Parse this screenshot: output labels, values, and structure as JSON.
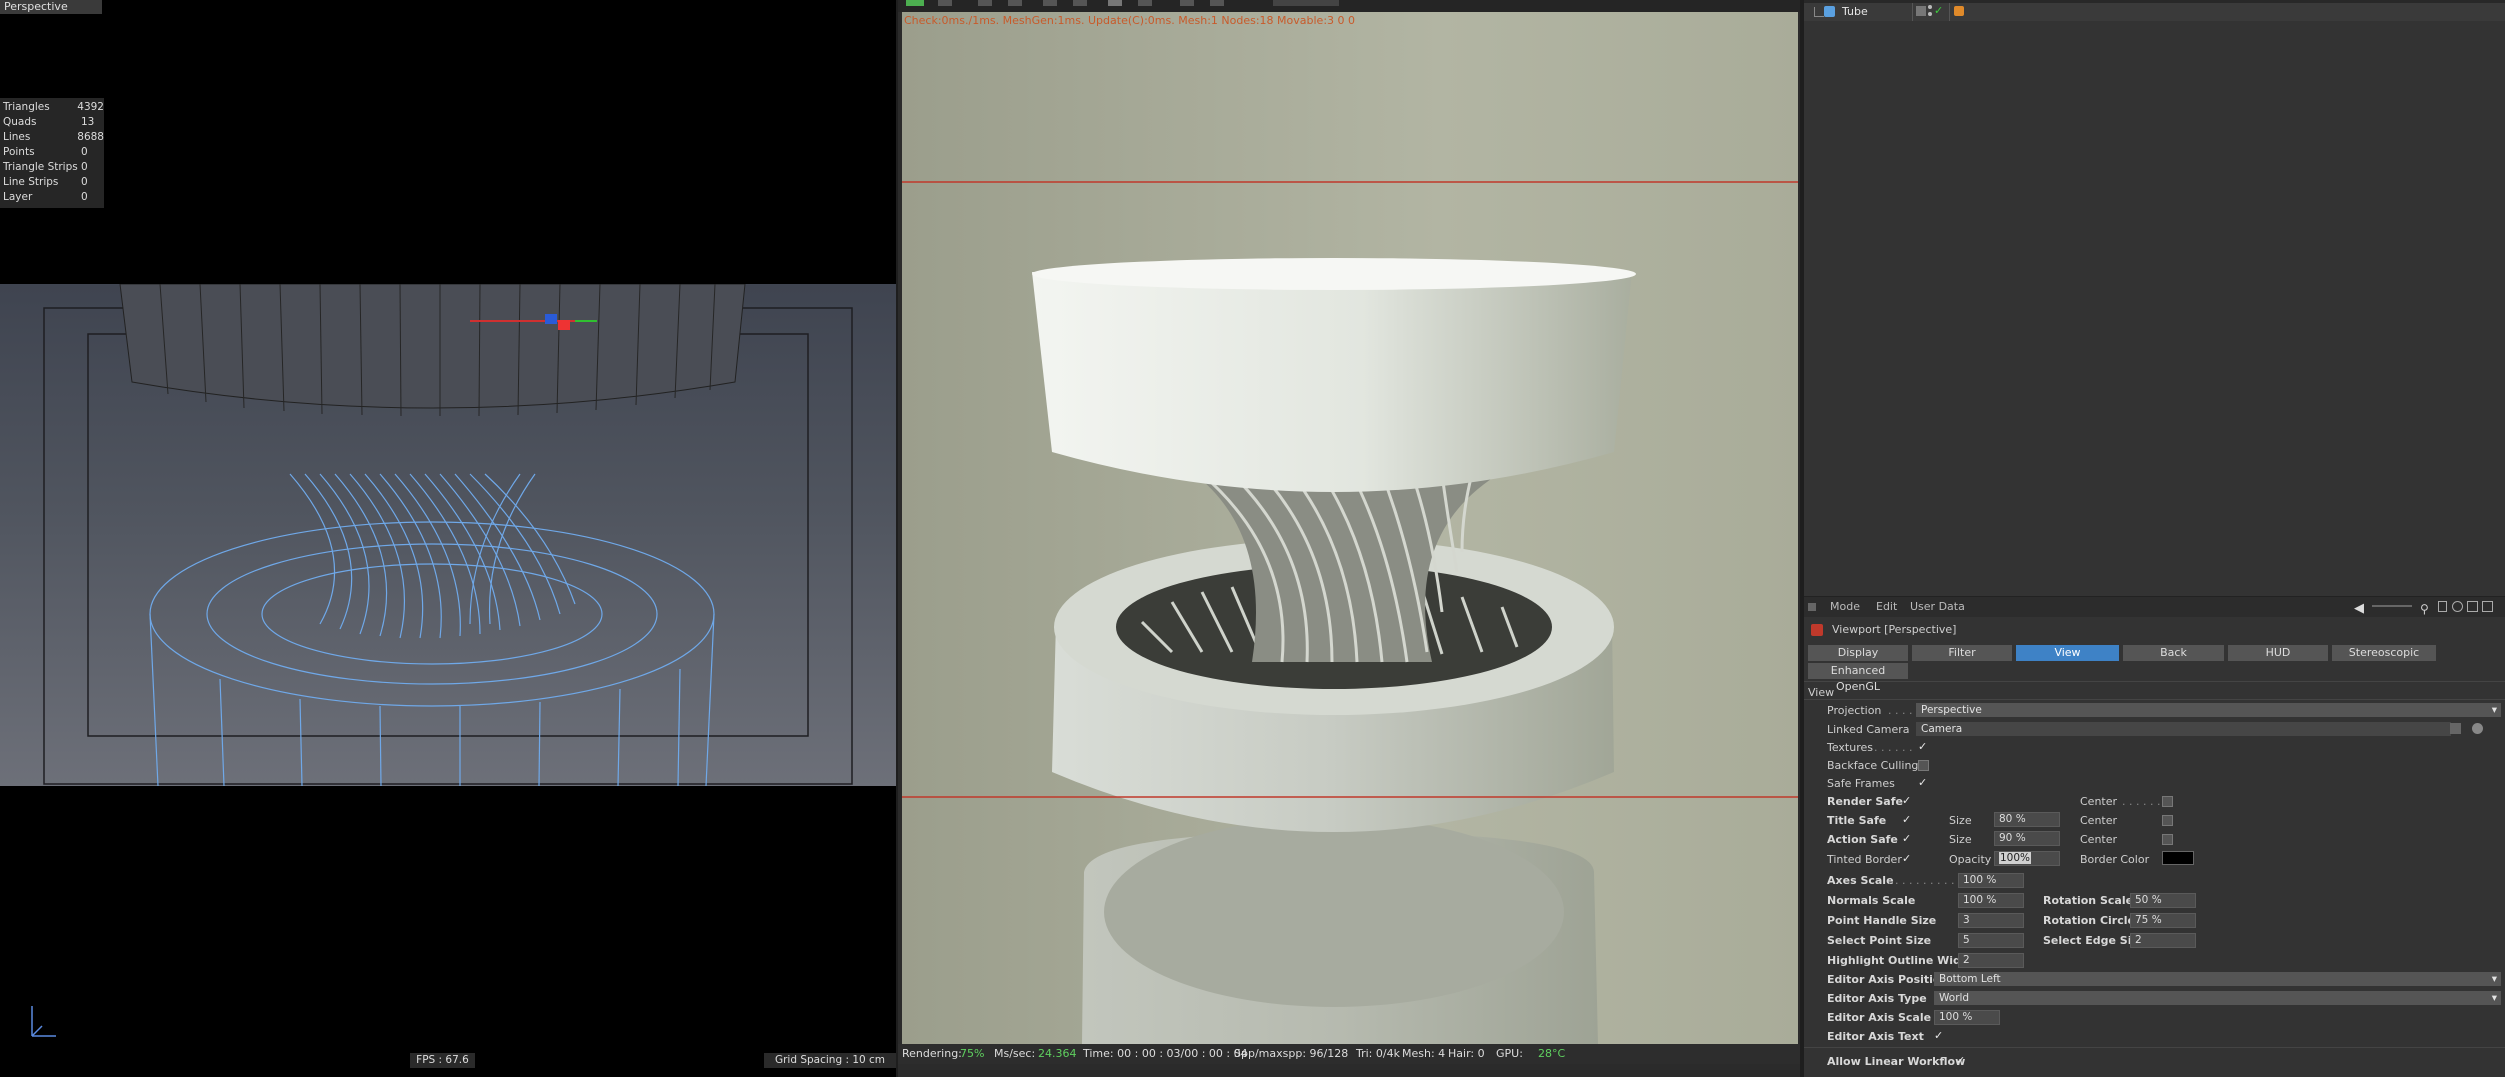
{
  "left_viewport": {
    "tab_label": "Perspective",
    "stats": [
      {
        "label": "Triangles",
        "value": "4392"
      },
      {
        "label": "Quads",
        "value": "13"
      },
      {
        "label": "Lines",
        "value": "8688"
      },
      {
        "label": "Points",
        "value": "0"
      },
      {
        "label": "Triangle Strips",
        "value": "0"
      },
      {
        "label": "Line Strips",
        "value": "0"
      },
      {
        "label": "Layer",
        "value": "0"
      }
    ],
    "fps": "FPS : 67.6",
    "grid_spacing": "Grid Spacing : 10 cm"
  },
  "render_viewport": {
    "check_text": "Check:0ms./1ms. MeshGen:1ms. Update(C):0ms. Mesh:1 Nodes:18 Movable:3  0 0",
    "status": {
      "rendering_label": "Rendering:",
      "rendering_value": "75%",
      "ms_sec_label": "Ms/sec:",
      "ms_sec_value": "24.364",
      "time": "Time: 00 : 00 : 03/00 : 00 : 04",
      "spp": "Spp/maxspp: 96/128",
      "tri": "Tri: 0/4k",
      "mesh": "Mesh: 4",
      "hair": "Hair: 0",
      "gpu_label": "GPU:",
      "gpu_value": "28°C"
    }
  },
  "object_manager": {
    "object_name": "Tube"
  },
  "attribute_manager": {
    "menu": [
      "Mode",
      "Edit",
      "User Data"
    ],
    "title": "Viewport [Perspective]",
    "tabs": [
      "Display",
      "Filter",
      "View",
      "Back",
      "HUD",
      "Stereoscopic"
    ],
    "active_tab": "View",
    "extra_tab": "Enhanced OpenGL",
    "section": "View",
    "projection": {
      "label": "Projection",
      "value": "Perspective"
    },
    "linked_camera": {
      "label": "Linked Camera",
      "value": "Camera"
    },
    "textures": {
      "label": "Textures",
      "checked": "✓"
    },
    "backface_culling": {
      "label": "Backface Culling"
    },
    "safe_frames": {
      "label": "Safe Frames",
      "checked": "✓"
    },
    "render_safe": {
      "label": "Render Safe",
      "checked": "✓",
      "center": "Center"
    },
    "title_safe": {
      "label": "Title Safe",
      "checked": "✓",
      "size_label": "Size",
      "size": "80 %",
      "center": "Center"
    },
    "action_safe": {
      "label": "Action Safe",
      "checked": "✓",
      "size_label": "Size",
      "size": "90 %",
      "center": "Center"
    },
    "tinted_border": {
      "label": "Tinted Border",
      "checked": "✓",
      "opacity_label": "Opacity",
      "opacity": "100%",
      "border_color_label": "Border Color"
    },
    "axes_scale": {
      "label": "Axes Scale",
      "value": "100 %"
    },
    "normals_scale": {
      "label": "Normals Scale",
      "value": "100 %"
    },
    "rotation_scale": {
      "label": "Rotation Scale",
      "value": "50 %"
    },
    "point_handle_size": {
      "label": "Point Handle Size",
      "value": "3"
    },
    "rotation_circle": {
      "label": "Rotation Circle",
      "value": "75 %"
    },
    "select_point_size": {
      "label": "Select Point Size",
      "value": "5"
    },
    "select_edge_size": {
      "label": "Select Edge Size",
      "value": "2"
    },
    "highlight_outline_width": {
      "label": "Highlight Outline Width",
      "value": "2"
    },
    "editor_axis_position": {
      "label": "Editor Axis Position",
      "value": "Bottom Left"
    },
    "editor_axis_type": {
      "label": "Editor Axis Type",
      "value": "World"
    },
    "editor_axis_scale": {
      "label": "Editor Axis Scale",
      "value": "100 %"
    },
    "editor_axis_text": {
      "label": "Editor Axis Text",
      "checked": "✓"
    },
    "allow_linear_workflow": {
      "label": "Allow Linear Workflow",
      "checked": "✓"
    }
  },
  "colors": {
    "accent": "#3e82c6",
    "render_bg": "#aeb1a0",
    "wire": "#6fa8e8",
    "safe_frame_line": "#c0392b"
  }
}
